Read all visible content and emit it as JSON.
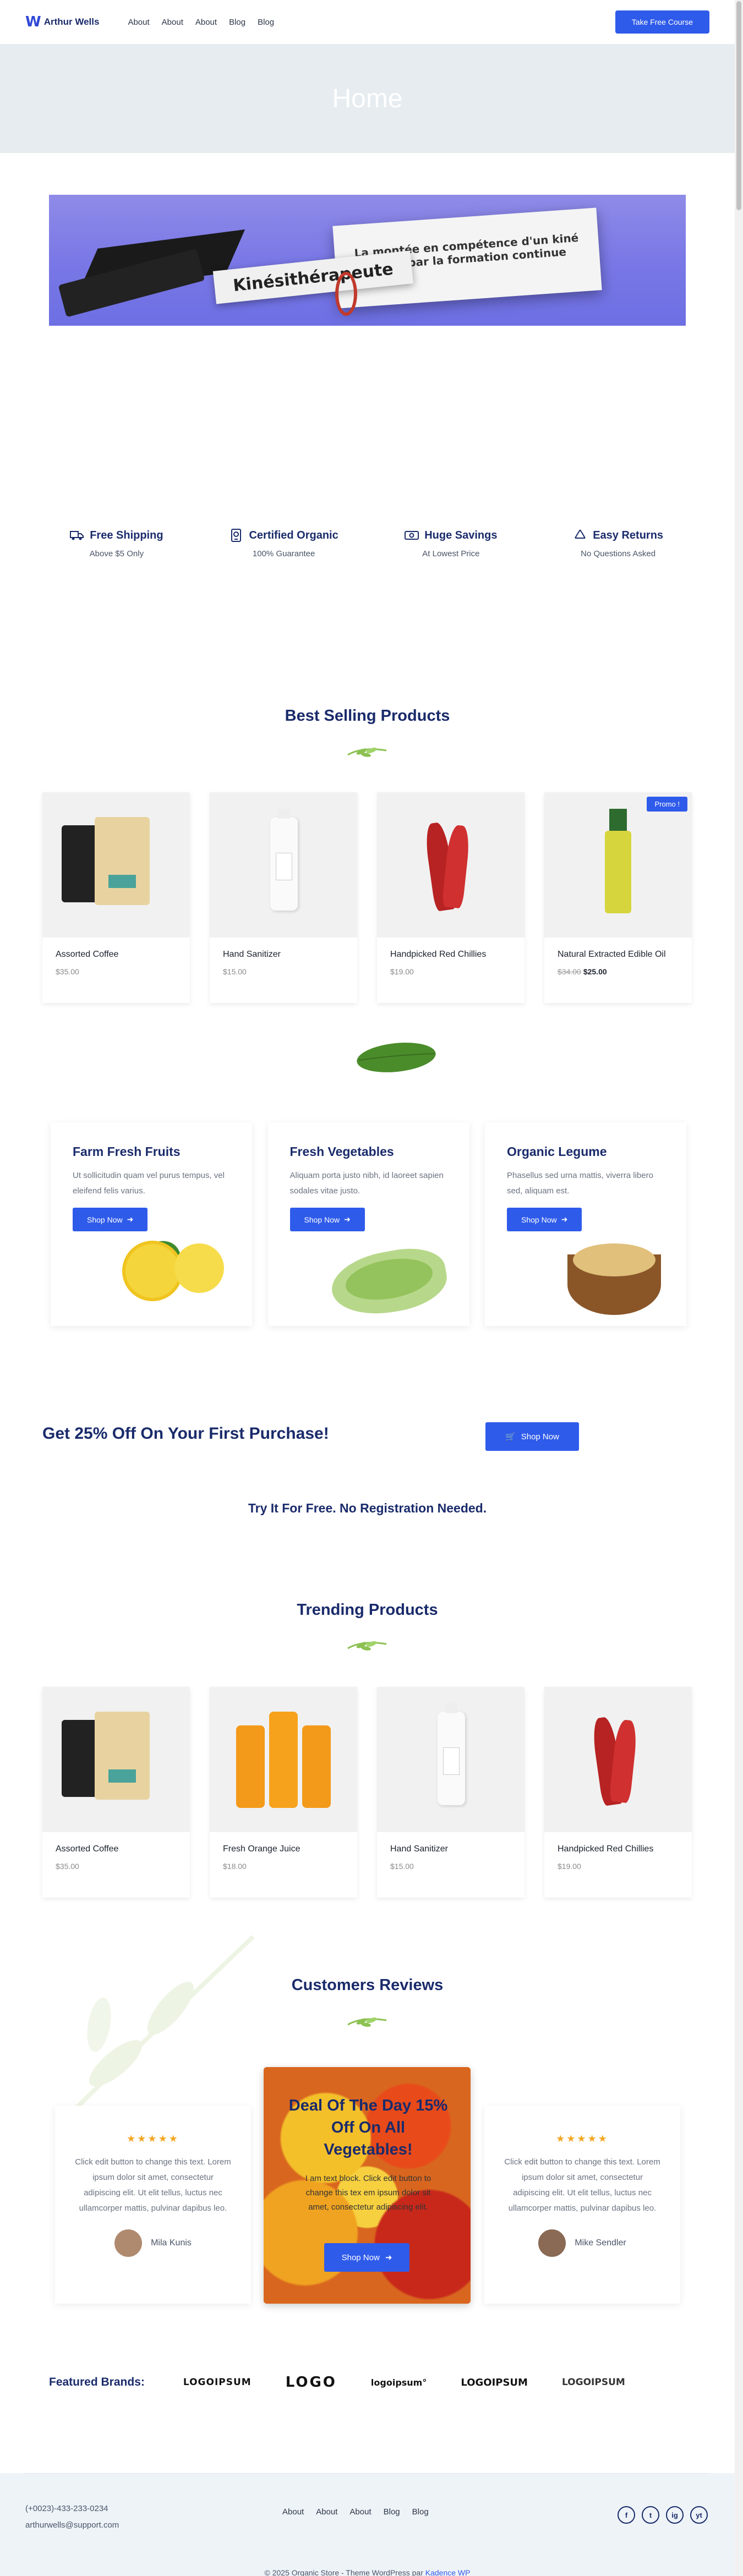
{
  "header": {
    "logo_mark": "W",
    "site_name": "Arthur Wells",
    "nav": [
      "About",
      "About",
      "About",
      "Blog",
      "Blog"
    ],
    "cta_label": "Take Free Course"
  },
  "hero": {
    "title": "Home"
  },
  "banner": {
    "card_text": "La montée en compétence d'un kiné passe par la formation continue",
    "scroll_text": "Kinésithérapeute"
  },
  "features": [
    {
      "icon": "truck-icon",
      "title": "Free Shipping",
      "subtitle": "Above $5 Only"
    },
    {
      "icon": "badge-icon",
      "title": "Certified Organic",
      "subtitle": "100% Guarantee"
    },
    {
      "icon": "money-icon",
      "title": "Huge Savings",
      "subtitle": "At Lowest Price"
    },
    {
      "icon": "recycle-icon",
      "title": "Easy Returns",
      "subtitle": "No Questions Asked"
    }
  ],
  "best_selling": {
    "title": "Best Selling Products",
    "products": [
      {
        "name": "Assorted Coffee",
        "price": "$35.00"
      },
      {
        "name": "Hand Sanitizer",
        "price": "$15.00"
      },
      {
        "name": "Handpicked Red Chillies",
        "price": "$19.00"
      },
      {
        "name": "Natural Extracted Edible Oil",
        "old_price": "$34.00",
        "price": "$25.00",
        "badge": "Promo !"
      }
    ]
  },
  "categories": [
    {
      "title": "Farm Fresh Fruits",
      "text": "Ut sollicitudin quam vel purus tempus, vel eleifend felis varius.",
      "button": "Shop Now"
    },
    {
      "title": "Fresh Vegetables",
      "text": "Aliquam porta justo nibh, id laoreet sapien sodales vitae justo.",
      "button": "Shop Now"
    },
    {
      "title": "Organic Legume",
      "text": "Phasellus sed urna mattis, viverra libero sed, aliquam est.",
      "button": "Shop Now"
    }
  ],
  "promo": {
    "headline": "Get 25% Off On Your First Purchase!",
    "button": "Shop Now",
    "tagline": "Try It For Free. No Registration Needed."
  },
  "trending": {
    "title": "Trending Products",
    "products": [
      {
        "name": "Assorted Coffee",
        "price": "$35.00"
      },
      {
        "name": "Fresh Orange Juice",
        "price": "$18.00"
      },
      {
        "name": "Hand Sanitizer",
        "price": "$15.00"
      },
      {
        "name": "Handpicked Red Chillies",
        "price": "$19.00"
      }
    ]
  },
  "reviews": {
    "title": "Customers Reviews",
    "stars": "★★★★★",
    "items": [
      {
        "text": "Click edit button to change this text. Lorem ipsum dolor sit amet, consectetur adipiscing elit. Ut elit tellus, luctus nec ullamcorper mattis, pulvinar dapibus leo.",
        "author": "Mila Kunis"
      },
      {
        "text": "Click edit button to change this text. Lorem ipsum dolor sit amet, consectetur adipiscing elit. Ut elit tellus, luctus nec ullamcorper mattis, pulvinar dapibus leo.",
        "author": "Mike Sendler"
      }
    ],
    "deal": {
      "title": "Deal Of The Day 15% Off On All Vegetables!",
      "text": "I am text block. Click edit button to change this tex em ipsum dolor sit amet, consectetur adipiscing elit.",
      "button": "Shop Now"
    }
  },
  "brands": {
    "label": "Featured Brands:",
    "items": [
      "LOGOIPSUM",
      "LOGO",
      "logoipsum°",
      "LOGOIPSUM",
      "LOGOIPSUM"
    ]
  },
  "footer": {
    "phone": "(+0023)-433-233-0234",
    "email": "arthurwells@support.com",
    "nav": [
      "About",
      "About",
      "About",
      "Blog",
      "Blog"
    ],
    "social": [
      "f",
      "t",
      "ig",
      "yt"
    ],
    "copyright": "© 2025 Organic Store - Theme WordPress par",
    "copyright_link": "Kadence WP"
  },
  "colors": {
    "accent": "#2f5bea",
    "heading": "#1a2b6b",
    "hero_bg": "#e6ecef"
  }
}
